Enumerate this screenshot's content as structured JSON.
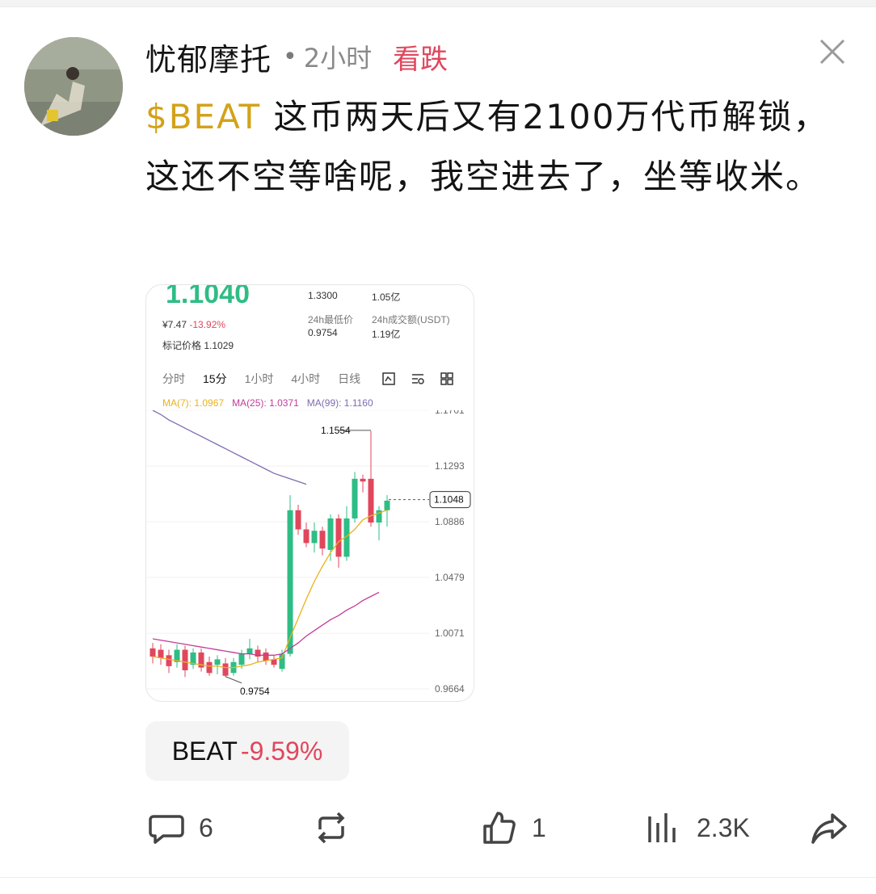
{
  "post": {
    "username": "忧郁摩托",
    "time": "2小时",
    "sentiment": "看跌",
    "ticker": "$BEAT",
    "text": " 这币两天后又有2100万代币解锁，这还不空等啥呢，我空进去了，坐等收米。"
  },
  "chart": {
    "price": "1.1040",
    "cny": "¥7.47",
    "change": "-13.92%",
    "mark_label": "标记价格",
    "mark_value": "1.1029",
    "high_value": "1.3300",
    "vol_value": "1.05亿",
    "low_label": "24h最低价",
    "low_value": "0.9754",
    "amount_label": "24h成交额(USDT)",
    "amount_value": "1.19亿",
    "tabs": [
      "分时",
      "15分",
      "1小时",
      "4小时",
      "日线"
    ],
    "active_tab": "15分",
    "ma7": "MA(7): 1.0967",
    "ma25": "MA(25): 1.0371",
    "ma99": "MA(99): 1.1160",
    "price_axis": [
      "1.1701",
      "1.1293",
      "1.0886",
      "1.0479",
      "1.0071",
      "0.9664"
    ],
    "current_tag": "1.1048",
    "high_mark": "1.1554",
    "low_mark": "0.9754",
    "colors": {
      "up": "#2ebd85",
      "down": "#e0475d",
      "ma7": "#e9b21c",
      "ma25": "#c13c9a",
      "ma99": "#7f6bb0"
    }
  },
  "badge": {
    "symbol": "BEAT",
    "change": "-9.59%"
  },
  "actions": {
    "comments": "6",
    "likes": "1",
    "views": "2.3K",
    "icons": [
      "comment-icon",
      "repost-icon",
      "like-icon",
      "views-icon",
      "share-icon"
    ]
  }
}
